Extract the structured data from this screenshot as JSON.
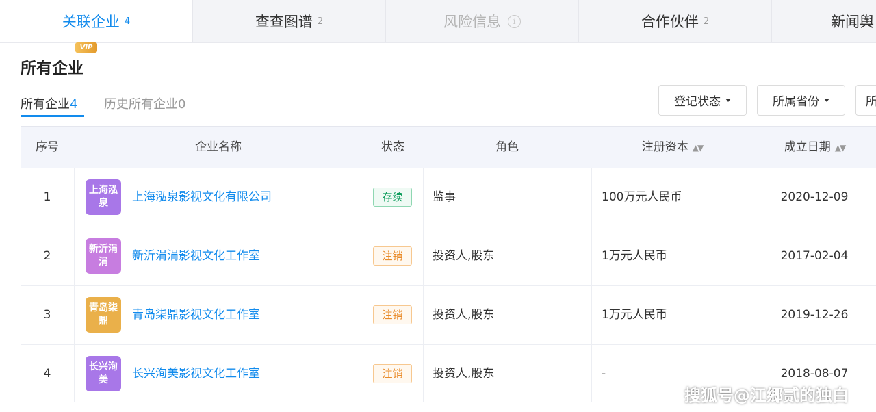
{
  "tabs": [
    {
      "label": "关联企业",
      "count": "4"
    },
    {
      "label": "查查图谱",
      "count": "2"
    },
    {
      "label": "风险信息",
      "count": ""
    },
    {
      "label": "合作伙伴",
      "count": "2"
    },
    {
      "label": "新闻舆",
      "count": ""
    }
  ],
  "section": {
    "title": "所有企业",
    "vip": "VIP"
  },
  "subtabs": {
    "all_label": "所有企业",
    "all_count": "4",
    "history_label": "历史所有企业",
    "history_count": "0"
  },
  "filters": {
    "status": "登记状态",
    "province": "所属省份",
    "more": "所"
  },
  "table": {
    "headers": {
      "index": "序号",
      "name": "企业名称",
      "status": "状态",
      "role": "角色",
      "capital": "注册资本",
      "date": "成立日期"
    },
    "rows": [
      {
        "index": "1",
        "logo": "上海泓泉",
        "logo_color": "#a877e8",
        "name": "上海泓泉影视文化有限公司",
        "status": "存续",
        "status_type": "active",
        "role": "监事",
        "capital": "100万元人民币",
        "date": "2020-12-09"
      },
      {
        "index": "2",
        "logo": "新沂涓涓",
        "logo_color": "#c77de0",
        "name": "新沂涓涓影视文化工作室",
        "status": "注销",
        "status_type": "cancel",
        "role": "投资人,股东",
        "capital": "1万元人民币",
        "date": "2017-02-04"
      },
      {
        "index": "3",
        "logo": "青岛柒鼎",
        "logo_color": "#eab04a",
        "name": "青岛柒鼎影视文化工作室",
        "status": "注销",
        "status_type": "cancel",
        "role": "投资人,股东",
        "capital": "1万元人民币",
        "date": "2019-12-26"
      },
      {
        "index": "4",
        "logo": "长兴洵美",
        "logo_color": "#a877e8",
        "name": "长兴洵美影视文化工作室",
        "status": "注销",
        "status_type": "cancel",
        "role": "投资人,股东",
        "capital": "-",
        "date": "2018-08-07"
      }
    ]
  },
  "watermark": "搜狐号@江郷贰的独白",
  "colors": {
    "accent": "#128bed",
    "active_status": "#0d9d5c",
    "cancel_status": "#e98b2a"
  }
}
